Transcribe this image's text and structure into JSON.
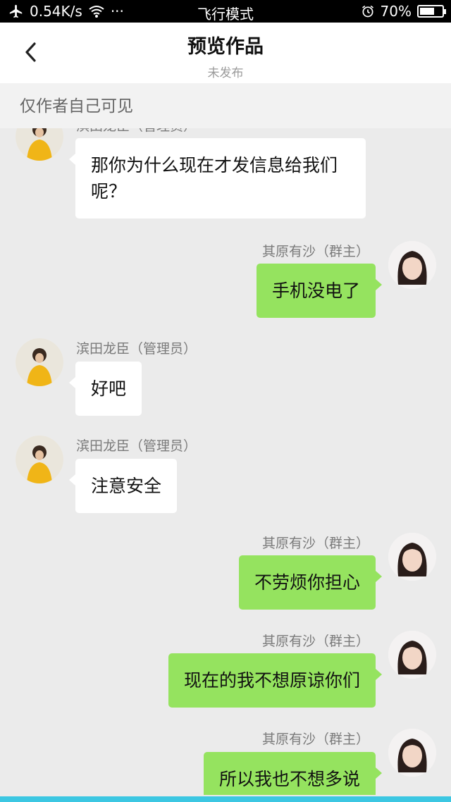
{
  "status_bar": {
    "network_speed": "0.54K/s",
    "dots": "···",
    "mode": "飞行模式",
    "battery": "70%",
    "battery_level": 0.7,
    "icons": [
      "airplane-icon",
      "wifi-icon",
      "alarm-icon",
      "battery-icon"
    ]
  },
  "header": {
    "back_icon": "chevron-left-icon",
    "title": "预览作品",
    "subtitle": "未发布"
  },
  "notice": "仅作者自己可见",
  "colors": {
    "sent_bubble": "#95e35f",
    "received_bubble": "#ffffff",
    "chat_background": "#ebebeb",
    "bottom_accent": "#3cc7e2"
  },
  "messages": [
    {
      "side": "left",
      "sender": "滨田龙臣（管理员）",
      "text": "那你为什么现在才发信息给我们呢？",
      "avatar": "yellow-jacket-avatar"
    },
    {
      "side": "right",
      "sender": "其原有沙（群主）",
      "text": "手机没电了",
      "avatar": "girl-avatar"
    },
    {
      "side": "left",
      "sender": "滨田龙臣（管理员）",
      "text": "好吧",
      "avatar": "yellow-jacket-avatar"
    },
    {
      "side": "left",
      "sender": "滨田龙臣（管理员）",
      "text": "注意安全",
      "avatar": "yellow-jacket-avatar"
    },
    {
      "side": "right",
      "sender": "其原有沙（群主）",
      "text": "不劳烦你担心",
      "avatar": "girl-avatar"
    },
    {
      "side": "right",
      "sender": "其原有沙（群主）",
      "text": "现在的我不想原谅你们",
      "avatar": "girl-avatar"
    },
    {
      "side": "right",
      "sender": "其原有沙（群主）",
      "text": "所以我也不想多说",
      "avatar": "girl-avatar"
    }
  ]
}
